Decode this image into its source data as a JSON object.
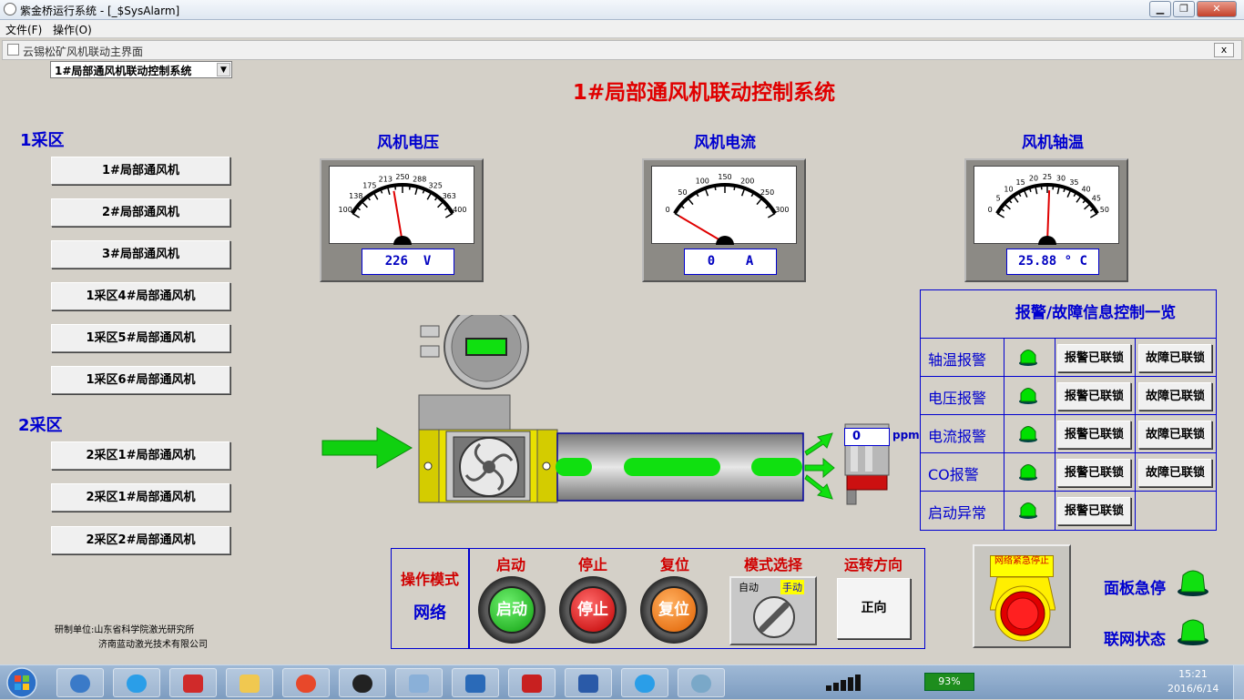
{
  "window": {
    "title": "紫金桥运行系统 - [_$SysAlarm]"
  },
  "menu": [
    "文件(F)",
    "操作(O)"
  ],
  "subwindow": {
    "title": "云锡松矿风机联动主界面",
    "close": "x"
  },
  "system_select": {
    "value": "1#局部通风机联动控制系统"
  },
  "main_title": "1#局部通风机联动控制系统",
  "zones": [
    {
      "label": "1采区",
      "fans": [
        "1#局部通风机",
        "2#局部通风机",
        "3#局部通风机",
        "1采区4#局部通风机",
        "1采区5#局部通风机",
        "1采区6#局部通风机"
      ]
    },
    {
      "label": "2采区",
      "fans": [
        "2采区1#局部通风机",
        "2采区1#局部通风机",
        "2采区2#局部通风机"
      ]
    }
  ],
  "credits": [
    "研制单位:山东省科学院激光研究所",
    "济南蓝动激光技术有限公司"
  ],
  "gauges": [
    {
      "title": "风机电压",
      "ticks": [
        "100",
        "138",
        "175",
        "213",
        "250",
        "288",
        "325",
        "363",
        "400"
      ],
      "min": 100,
      "max": 400,
      "value": 226,
      "display": "226  V"
    },
    {
      "title": "风机电流",
      "ticks": [
        "0",
        "50",
        "100",
        "150",
        "200",
        "250",
        "300"
      ],
      "min": 0,
      "max": 300,
      "value": 0,
      "display": "0    A"
    },
    {
      "title": "风机轴温",
      "ticks": [
        "0",
        "5",
        "10",
        "15",
        "20",
        "25",
        "30",
        "35",
        "40",
        "45",
        "50"
      ],
      "min": 0,
      "max": 50,
      "value": 25.88,
      "display": "25.88 ° C"
    }
  ],
  "co_sensor": {
    "value": "0",
    "unit": "ppm"
  },
  "alarm": {
    "header": "报警/故障信息控制一览",
    "rows": [
      {
        "label": "轴温报警",
        "alarm_btn": "报警已联锁",
        "fault_btn": "故障已联锁"
      },
      {
        "label": "电压报警",
        "alarm_btn": "报警已联锁",
        "fault_btn": "故障已联锁"
      },
      {
        "label": "电流报警",
        "alarm_btn": "报警已联锁",
        "fault_btn": "故障已联锁"
      },
      {
        "label": "CO报警",
        "alarm_btn": "报警已联锁",
        "fault_btn": "故障已联锁"
      },
      {
        "label": "启动异常",
        "alarm_btn": "报警已联锁",
        "fault_btn": ""
      }
    ]
  },
  "op_mode": {
    "label": "操作模式",
    "value": "网络"
  },
  "controls": {
    "start_label": "启动",
    "stop_label": "停止",
    "reset_label": "复位",
    "mode_label": "模式选择",
    "dir_label": "运转方向",
    "start_btn": "启动",
    "stop_btn": "停止",
    "reset_btn": "复位",
    "mode_auto": "自动",
    "mode_manual": "手动",
    "direction": "正向"
  },
  "estop": {
    "plate": "网络紧急停止"
  },
  "panel_status": {
    "panel_estop": "面板急停",
    "network": "联网状态"
  },
  "tray": {
    "battery": "93%",
    "time": "15:21",
    "date": "2016/6/14"
  },
  "colors": {
    "accent": "#0000d0",
    "title_red": "#e00000",
    "lamp_green": "#00e000",
    "airflow": "#10e010"
  }
}
